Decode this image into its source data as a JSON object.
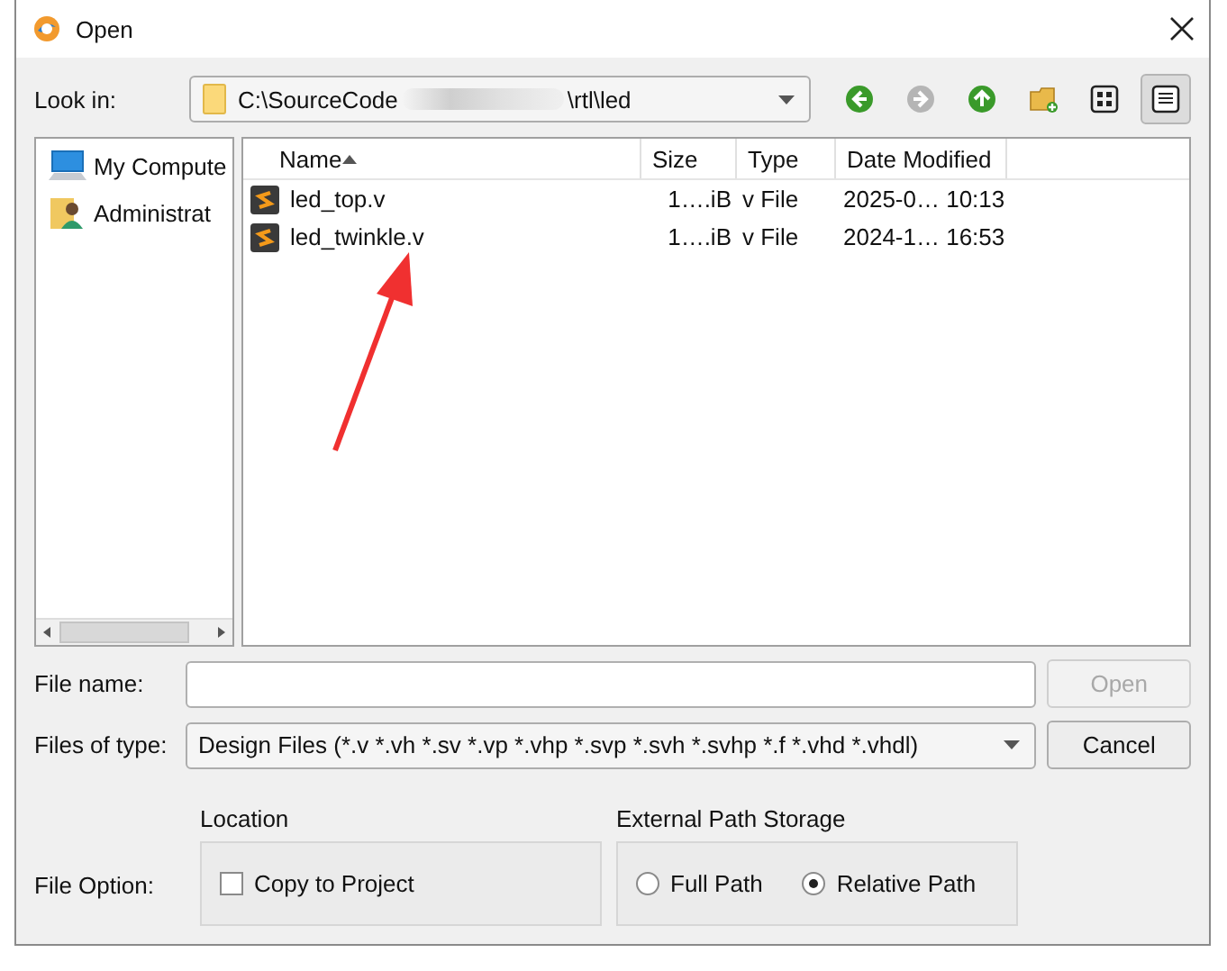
{
  "window": {
    "title": "Open"
  },
  "look_in": {
    "label": "Look in:",
    "path_start": "C:\\SourceCode",
    "path_end": "\\rtl\\led"
  },
  "nav_buttons": [
    {
      "kind": "back",
      "disabled": false
    },
    {
      "kind": "forward",
      "disabled": true
    },
    {
      "kind": "up",
      "disabled": false
    },
    {
      "kind": "new_folder",
      "disabled": false
    }
  ],
  "view_modes": [
    {
      "kind": "icons",
      "selected": false
    },
    {
      "kind": "detail",
      "selected": true
    }
  ],
  "sidebar": {
    "items": [
      {
        "kind": "computer",
        "label": "My Compute"
      },
      {
        "kind": "user",
        "label": "Administrat"
      }
    ]
  },
  "table": {
    "columns": [
      {
        "label": "Name",
        "sorted": true
      },
      {
        "label": "Size",
        "sorted": false
      },
      {
        "label": "Type",
        "sorted": false
      },
      {
        "label": "Date Modified",
        "sorted": false
      }
    ],
    "rows": [
      {
        "name": "led_top.v",
        "size": "1….iB",
        "type": "v File",
        "date": "2025-0… 10:13"
      },
      {
        "name": "led_twinkle.v",
        "size": "1….iB",
        "type": "v File",
        "date": "2024-1… 16:53"
      }
    ]
  },
  "file_name": {
    "label": "File name:"
  },
  "files_of_type": {
    "label": "Files of type:",
    "value": "Design Files (*.v *.vh *.sv *.vp *.vhp *.svp *.svh *.svhp *.f *.vhd *.vhdl)"
  },
  "buttons": [
    {
      "label": "Open",
      "disabled": true
    },
    {
      "label": "Cancel",
      "disabled": false
    }
  ],
  "file_option": {
    "label": "File Option:",
    "location": {
      "title": "Location",
      "checkbox": {
        "label": "Copy to Project",
        "checked": false
      }
    },
    "path_storage": {
      "title": "External Path Storage",
      "options": [
        {
          "label": "Full Path",
          "selected": false
        },
        {
          "label": "Relative Path",
          "selected": true
        }
      ]
    }
  }
}
